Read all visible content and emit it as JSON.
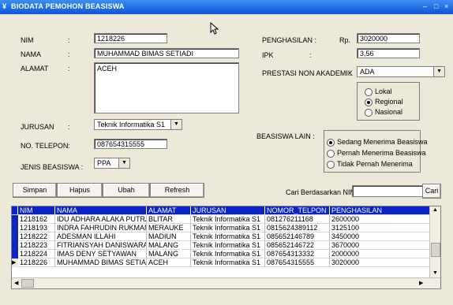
{
  "window": {
    "title": "BIODATA PEMOHON BEASISWA",
    "icon": "app-icon",
    "controls": [
      "–",
      "□",
      "×"
    ]
  },
  "form": {
    "nim_label": "NIM",
    "nama_label": "NAMA",
    "alamat_label": "ALAMAT",
    "jurusan_label": "JURUSAN",
    "telepon_label": "NO. TELEPON",
    "jenis_label": "JENIS BEASISWA :",
    "colon": ":",
    "nim_value": "1218226",
    "nama_value": "MUHAMMAD BIMAS SETIADI",
    "alamat_value": "ACEH",
    "jurusan_value": "Teknik Informatika S1",
    "telepon_value": "087654315555",
    "jenis_value": "PPA",
    "penghasilan_label": "PENGHASILAN :",
    "rp_label": "Rp.",
    "penghasilan_value": "3020000",
    "ipk_label": "IPK",
    "ipk_value": "3,56",
    "prestasi_label": "PRESTASI NON AKADEMIK",
    "prestasi_value": "ADA",
    "tingkat_options": [
      {
        "label": "Lokal",
        "selected": false
      },
      {
        "label": "Regional",
        "selected": true
      },
      {
        "label": "Nasional",
        "selected": false
      }
    ],
    "beasiswa_lain_label": "BEASISWA LAIN :",
    "beasiswa_lain_options": [
      {
        "label": "Sedang Menerima Beasiswa",
        "selected": true
      },
      {
        "label": "Pernah Menerima Beasiswa",
        "selected": false
      },
      {
        "label": "Tidak Pernah Menerima",
        "selected": false
      }
    ]
  },
  "toolbar": {
    "simpan": "Simpan",
    "hapus": "Hapus",
    "ubah": "Ubah",
    "refresh": "Refresh",
    "cari_label": "Cari Berdasarkan NIM",
    "cari_value": "",
    "cari_button": "Cari"
  },
  "table": {
    "headers": [
      "NIM",
      "NAMA",
      "ALAMAT",
      "JURUSAN",
      "NOMOR_TELPON",
      "PENGHASILAN"
    ],
    "rows": [
      [
        "1218162",
        "IDU ADHARA ALAKA PUTRA",
        "BLITAR",
        "Teknik Informatika S1",
        "081276211168",
        "2600000"
      ],
      [
        "1218193",
        "INDRA FAHRUDIN RUKMANA",
        "MERAUKE",
        "Teknik Informatika S1",
        "0815624389112",
        "3125100"
      ],
      [
        "1218222",
        "ADESMAN ILLAHI",
        "MADIUN",
        "Teknik Informatika S1",
        "085652146789",
        "3450000"
      ],
      [
        "1218223",
        "FITRIANSYAH DANISWARA P",
        "MALANG",
        "Teknik Informatika S1",
        "085652146722",
        "3670000"
      ],
      [
        "1218224",
        "IMAS DENY SETYAWAN",
        "MALANG",
        "Teknik Informatika S1",
        "087654313332",
        "2000000"
      ],
      [
        "1218226",
        "MUHAMMAD BIMAS SETIADI",
        "ACEH",
        "Teknik Informatika S1",
        "087654315555",
        "3020000"
      ]
    ],
    "current_row_index": 5
  }
}
